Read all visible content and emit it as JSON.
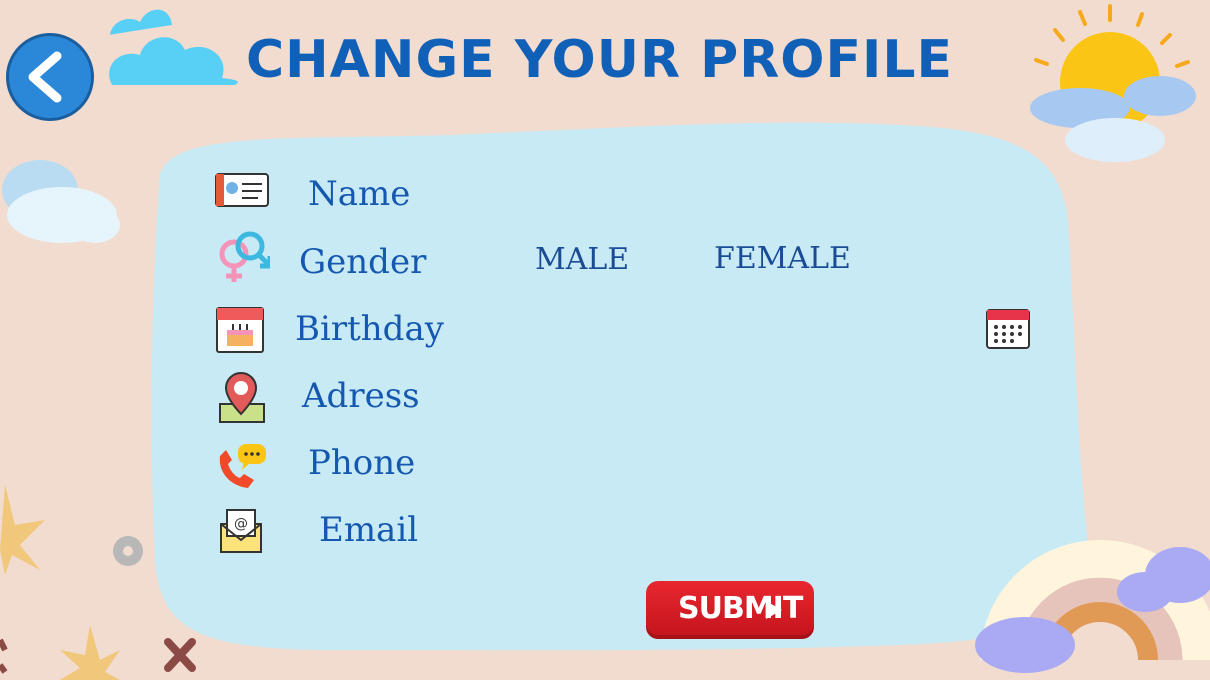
{
  "header": {
    "title": "CHANGE YOUR PROFILE"
  },
  "form": {
    "name_label": "Name",
    "gender_label": "Gender",
    "birthday_label": "Birthday",
    "address_label": "Adress",
    "phone_label": "Phone",
    "email_label": "Email",
    "gender_options": [
      "MALE",
      "FEMALE"
    ]
  },
  "submit": {
    "label": "SUBMIT"
  },
  "colors": {
    "panel": "#c8eaf5",
    "accent": "#1160b8",
    "background": "#f2dccf",
    "submit": "#d91c25"
  },
  "icons": [
    "back-arrow-icon",
    "id-card-icon",
    "gender-icon",
    "birthday-calendar-icon",
    "location-pin-icon",
    "phone-chat-icon",
    "email-envelope-icon",
    "date-picker-icon"
  ]
}
